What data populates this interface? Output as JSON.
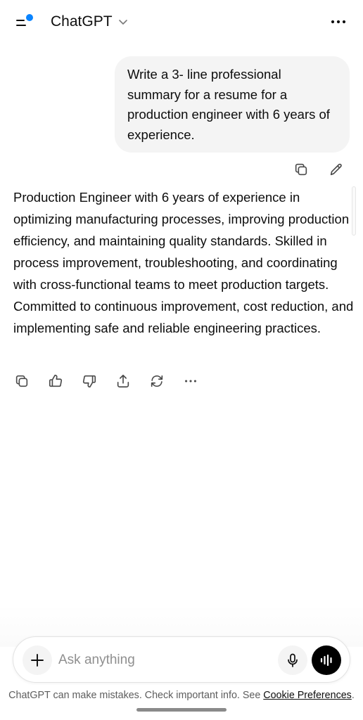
{
  "header": {
    "title": "ChatGPT",
    "menu_icon": "sidebar-menu-icon",
    "accent_color": "#0a84ff",
    "more_icon": "more-horizontal-icon"
  },
  "conversation": {
    "user_message": "Write a 3- line professional summary for a resume for a production engineer with 6 years of experience.",
    "assistant_message": "Production Engineer with 6 years of experience in optimizing manufacturing processes, improving production efficiency, and maintaining quality standards. Skilled in process improvement, troubleshooting, and coordinating with cross-functional teams to meet production targets. Committed to continuous improvement, cost reduction, and implementing safe and reliable engineering practices."
  },
  "user_actions": [
    "copy-icon",
    "edit-icon"
  ],
  "assistant_actions": [
    "copy-icon",
    "thumbs-up-icon",
    "thumbs-down-icon",
    "share-icon",
    "regenerate-icon",
    "more-horizontal-icon"
  ],
  "composer": {
    "placeholder": "Ask anything"
  },
  "footer": {
    "disclaimer": "ChatGPT can make mistakes. Check important info. See ",
    "link": "Cookie Preferences",
    "suffix": "."
  }
}
